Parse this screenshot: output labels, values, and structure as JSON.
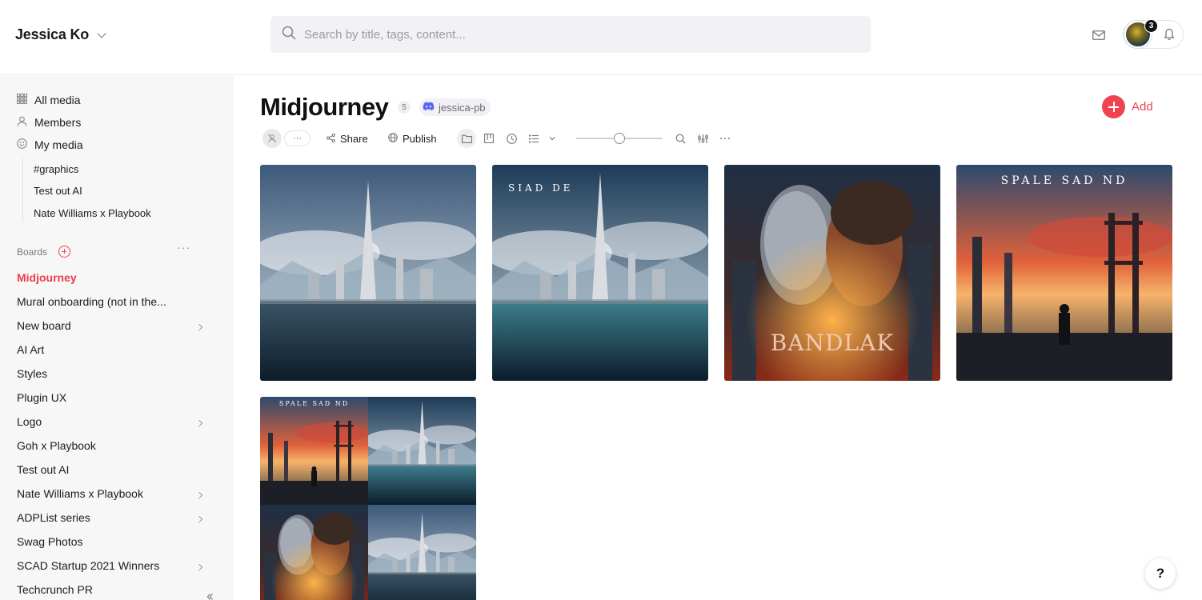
{
  "header": {
    "workspace_name": "Jessica Ko",
    "search_placeholder": "Search by title, tags, content...",
    "notification_count": "3"
  },
  "sidebar": {
    "nav": [
      {
        "label": "All media",
        "icon": "grid-icon"
      },
      {
        "label": "Members",
        "icon": "person-icon"
      },
      {
        "label": "My media",
        "icon": "smile-icon"
      }
    ],
    "my_media_children": [
      "#graphics",
      "Test out AI",
      "Nate Williams x Playbook"
    ],
    "boards_label": "Boards",
    "boards": [
      {
        "label": "Midjourney",
        "active": true,
        "has_children": false
      },
      {
        "label": "Mural onboarding (not in the...",
        "active": false,
        "has_children": false
      },
      {
        "label": "New board",
        "active": false,
        "has_children": true
      },
      {
        "label": "AI Art",
        "active": false,
        "has_children": false
      },
      {
        "label": "Styles",
        "active": false,
        "has_children": false
      },
      {
        "label": "Plugin UX",
        "active": false,
        "has_children": false
      },
      {
        "label": "Logo",
        "active": false,
        "has_children": true
      },
      {
        "label": "Goh x Playbook",
        "active": false,
        "has_children": false
      },
      {
        "label": "Test out AI",
        "active": false,
        "has_children": false
      },
      {
        "label": "Nate Williams x Playbook",
        "active": false,
        "has_children": true
      },
      {
        "label": "ADPList series",
        "active": false,
        "has_children": true
      },
      {
        "label": "Swag Photos",
        "active": false,
        "has_children": false
      },
      {
        "label": "SCAD Startup 2021 Winners",
        "active": false,
        "has_children": true
      },
      {
        "label": "Techcrunch PR",
        "active": false,
        "has_children": false
      }
    ]
  },
  "main": {
    "title": "Midjourney",
    "item_count": "5",
    "owner": "jessica-pb",
    "add_label": "Add",
    "toolbar": {
      "share_label": "Share",
      "publish_label": "Publish",
      "more_label": "···"
    },
    "zoom_level": 0.5,
    "tiles": [
      {
        "name": "futuristic-city-image",
        "poster_text": ""
      },
      {
        "name": "siad-de-poster-image",
        "poster_text": "SIAD DE"
      },
      {
        "name": "bandlak-poster-image",
        "poster_text": "BANDLAK"
      },
      {
        "name": "spale-sad-nd-poster-image",
        "poster_text": "SPALE SAD ND"
      },
      {
        "name": "grid-collage-image",
        "poster_text": "SPALE SAD ND"
      }
    ],
    "help_label": "?"
  }
}
